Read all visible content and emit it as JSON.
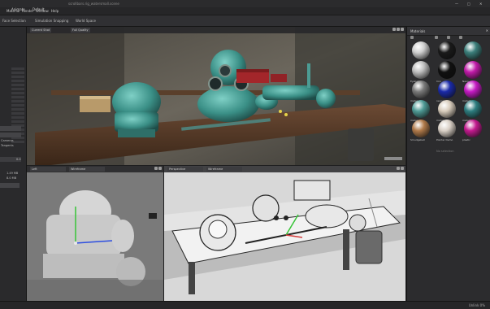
{
  "titlebar": {
    "title": "scrollbars.rig_watersmall.scene"
  },
  "menu": {
    "items": [
      "Material",
      "Render",
      "Window",
      "Help"
    ],
    "mode_a": "Animate",
    "mode_b": "Default"
  },
  "tabs": [
    "Face Selection",
    "Simulation Snapping",
    "World Space"
  ],
  "viewport_main": {
    "camera": "Current Shot",
    "quality": "Full Quality"
  },
  "viewport_left": {
    "camera": "Left",
    "shading": "Wireframe"
  },
  "viewport_persp": {
    "camera": "Perspective",
    "shading": "Wireframe"
  },
  "left_panel": {
    "labels": [
      "Cameras",
      "Tangents"
    ],
    "values": [
      "1.49 MB",
      "8.0 MB"
    ],
    "field": "0.0"
  },
  "materials": {
    "title": "Materials",
    "items": [
      {
        "label": "",
        "color": "#cfcfcf"
      },
      {
        "label": "",
        "color": "#1a1a1a"
      },
      {
        "label": "",
        "color": "#3b7e7a"
      },
      {
        "label": "Eyeballs",
        "color": "#bdbdbd"
      },
      {
        "label": "Iron",
        "color": "#101010"
      },
      {
        "label": "Neon",
        "color": "#c01aa8"
      },
      {
        "label": "metal",
        "color": "#7a7a7a"
      },
      {
        "label": "neonal",
        "color": "#1a2aa8"
      },
      {
        "label": "metal2",
        "color": "#c41ac2"
      },
      {
        "label": "metal",
        "color": "#4e9a95"
      },
      {
        "label": "metal",
        "color": "#d8ccbc"
      },
      {
        "label": "metal3",
        "color": "#2d7d7f"
      },
      {
        "label": "Smudgeball",
        "color": "#b07a4a"
      },
      {
        "label": "Pointer Demo",
        "color": "#d9d0c6"
      },
      {
        "label": "plastic",
        "color": "#c21a8e"
      }
    ],
    "footer": "No selection"
  },
  "status": {
    "zoom": "Unlink 0%"
  }
}
